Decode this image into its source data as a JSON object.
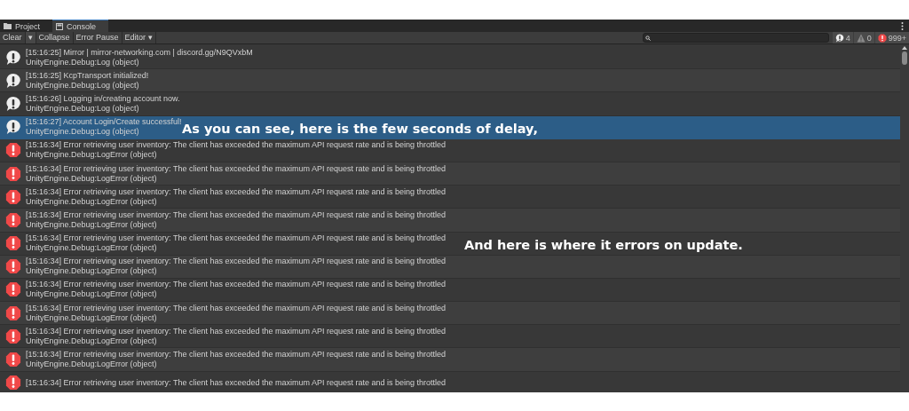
{
  "tabs": [
    {
      "label": "Project",
      "kind": "folder",
      "selected": false
    },
    {
      "label": "Console",
      "kind": "console",
      "selected": true
    }
  ],
  "toolbar": {
    "buttons": [
      {
        "label": "Clear",
        "kind": "button"
      },
      {
        "label": "▾",
        "kind": "dropdown"
      },
      {
        "label": "Collapse",
        "kind": "button"
      },
      {
        "label": "Error Pause",
        "kind": "button"
      },
      {
        "label": "Editor ▾",
        "kind": "button"
      }
    ],
    "counters": [
      {
        "kind": "info",
        "count": "4"
      },
      {
        "kind": "warning",
        "count": "0"
      },
      {
        "kind": "error",
        "count": "999+"
      }
    ]
  },
  "entries": [
    {
      "kind": "info",
      "message": "[15:16:25] Mirror | mirror-networking.com | discord.gg/N9QVxbM",
      "detail": "UnityEngine.Debug:Log (object)",
      "selected": false
    },
    {
      "kind": "info",
      "message": "[15:16:25] KcpTransport initialized!",
      "detail": "UnityEngine.Debug:Log (object)",
      "selected": false
    },
    {
      "kind": "info",
      "message": "[15:16:26] Logging in/creating account now.",
      "detail": "UnityEngine.Debug:Log (object)",
      "selected": false
    },
    {
      "kind": "info",
      "message": "[15:16:27] Account Login/Create successful!",
      "detail": "UnityEngine.Debug:Log (object)",
      "selected": true,
      "caption": "As you can see, here is the few seconds of delay,"
    },
    {
      "kind": "error",
      "message": "[15:16:34] Error retrieving user inventory: The client has exceeded the maximum API request rate and is being throttled",
      "detail": "UnityEngine.Debug:LogError (object)",
      "selected": false
    },
    {
      "kind": "error",
      "message": "[15:16:34] Error retrieving user inventory: The client has exceeded the maximum API request rate and is being throttled",
      "detail": "UnityEngine.Debug:LogError (object)",
      "selected": false
    },
    {
      "kind": "error",
      "message": "[15:16:34] Error retrieving user inventory: The client has exceeded the maximum API request rate and is being throttled",
      "detail": "UnityEngine.Debug:LogError (object)",
      "selected": false
    },
    {
      "kind": "error",
      "message": "[15:16:34] Error retrieving user inventory: The client has exceeded the maximum API request rate and is being throttled",
      "detail": "UnityEngine.Debug:LogError (object)",
      "selected": false
    },
    {
      "kind": "error",
      "message": "[15:16:34] Error retrieving user inventory: The client has exceeded the maximum API request rate and is being throttled",
      "detail": "UnityEngine.Debug:LogError (object)",
      "selected": false,
      "caption": "And here is where it errors on update."
    },
    {
      "kind": "error",
      "message": "[15:16:34] Error retrieving user inventory: The client has exceeded the maximum API request rate and is being throttled",
      "detail": "UnityEngine.Debug:LogError (object)",
      "selected": false
    },
    {
      "kind": "error",
      "message": "[15:16:34] Error retrieving user inventory: The client has exceeded the maximum API request rate and is being throttled",
      "detail": "UnityEngine.Debug:LogError (object)",
      "selected": false
    },
    {
      "kind": "error",
      "message": "[15:16:34] Error retrieving user inventory: The client has exceeded the maximum API request rate and is being throttled",
      "detail": "UnityEngine.Debug:LogError (object)",
      "selected": false
    },
    {
      "kind": "error",
      "message": "[15:16:34] Error retrieving user inventory: The client has exceeded the maximum API request rate and is being throttled",
      "detail": "UnityEngine.Debug:LogError (object)",
      "selected": false
    },
    {
      "kind": "error",
      "message": "[15:16:34] Error retrieving user inventory: The client has exceeded the maximum API request rate and is being throttled",
      "detail": "UnityEngine.Debug:LogError (object)",
      "selected": false
    },
    {
      "kind": "error",
      "message": "[15:16:34] Error retrieving user inventory: The client has exceeded the maximum API request rate and is being throttled",
      "selected": false
    }
  ]
}
